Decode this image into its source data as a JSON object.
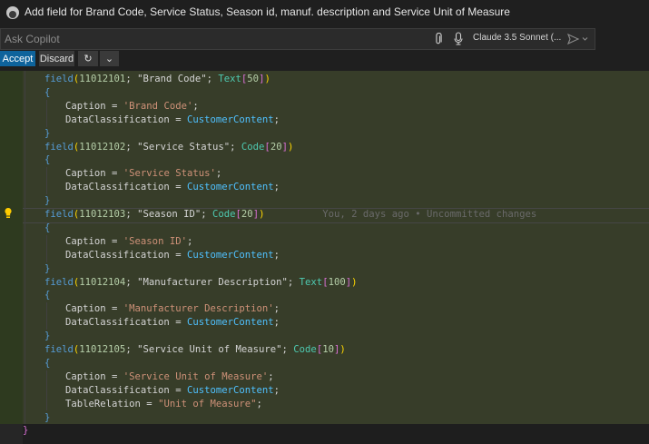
{
  "titlebar": {
    "title": "Add field for Brand Code, Service Status, Season id, manuf. description and Service Unit of Measure"
  },
  "copilot": {
    "placeholder": "Ask Copilot",
    "model": "Claude 3.5 Sonnet (...",
    "icons": [
      "paperclip-icon",
      "microphone-icon",
      "send-icon",
      "chevron-down-icon"
    ]
  },
  "actions": {
    "accept": "Accept",
    "discard": "Discard",
    "redo_icon": "↻",
    "more_icon": "⌄"
  },
  "code": {
    "blame": "You, 2 days ago • Uncommitted changes",
    "fields": [
      {
        "kw": "field",
        "id": "11012101",
        "name": "\"Brand Code\"",
        "type": "Text",
        "len": "50",
        "caption": "'Brand Code'",
        "dc": "CustomerContent"
      },
      {
        "kw": "field",
        "id": "11012102",
        "name": "\"Service Status\"",
        "type": "Code",
        "len": "20",
        "caption": "'Service Status'",
        "dc": "CustomerContent"
      },
      {
        "kw": "field",
        "id": "11012103",
        "name": "\"Season ID\"",
        "type": "Code",
        "len": "20",
        "caption": "'Season ID'",
        "dc": "CustomerContent"
      },
      {
        "kw": "field",
        "id": "11012104",
        "name": "\"Manufacturer Description\"",
        "type": "Text",
        "len": "100",
        "caption": "'Manufacturer Description'",
        "dc": "CustomerContent"
      },
      {
        "kw": "field",
        "id": "11012105",
        "name": "\"Service Unit of Measure\"",
        "type": "Code",
        "len": "10",
        "caption": "'Service Unit of Measure'",
        "dc": "CustomerContent",
        "tr": "\"Unit of Measure\""
      }
    ],
    "labels": {
      "caption": "Caption",
      "dataclass": "DataClassification",
      "tablerel": "TableRelation",
      "eq": " = ",
      "semi": ";"
    }
  }
}
